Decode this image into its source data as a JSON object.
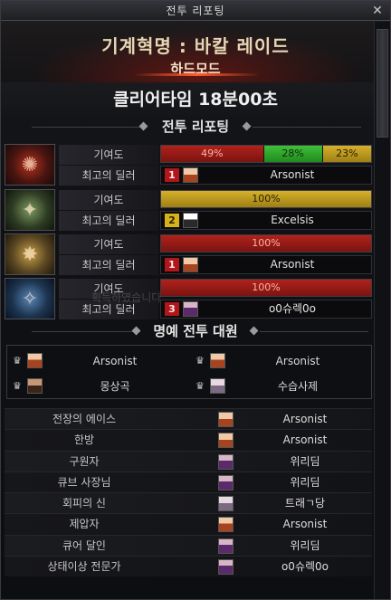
{
  "window": {
    "title": "전투 리포팅",
    "close": "✕"
  },
  "header": {
    "raid_title": "기계혁명 : 바칼 레이드",
    "mode": "하드모드"
  },
  "clear_time": "클리어타임  18분00초",
  "battle_section": {
    "title": "전투 리포팅"
  },
  "labels": {
    "contribution": "기여도",
    "top_dealer": "최고의 딜러"
  },
  "bosses": [
    {
      "icon": "boss-red-icon",
      "glyph": "✺",
      "segments": [
        {
          "label": "49%",
          "color": "#b0221c",
          "value": 49
        },
        {
          "label": "28%",
          "color": "#3fbf3a",
          "value": 28
        },
        {
          "label": "23%",
          "color": "#d6b12c",
          "value": 23
        }
      ],
      "dealer": {
        "rank": "1",
        "name": "Arsonist",
        "avatar": "arsonist"
      }
    },
    {
      "icon": "boss-green-icon",
      "glyph": "✦",
      "segments": [
        {
          "label": "100%",
          "color": "#d6b12c",
          "value": 100
        }
      ],
      "dealer": {
        "rank": "2",
        "name": "Excelsis",
        "avatar": "excelsis"
      }
    },
    {
      "icon": "boss-gold-icon",
      "glyph": "✸",
      "segments": [
        {
          "label": "100%",
          "color": "#b0221c",
          "value": 100
        }
      ],
      "dealer": {
        "rank": "1",
        "name": "Arsonist",
        "avatar": "arsonist"
      }
    },
    {
      "icon": "boss-blue-icon",
      "glyph": "✧",
      "segments": [
        {
          "label": "100%",
          "color": "#b0221c",
          "value": 100
        }
      ],
      "dealer": {
        "rank": "3",
        "name": "o0슈렉0o",
        "avatar": "dark"
      }
    }
  ],
  "overlay_text": "획득하였습니다",
  "honor_section": {
    "title": "명예 전투 대원",
    "members": [
      {
        "name": "Arsonist",
        "avatar": "arsonist"
      },
      {
        "name": "Arsonist",
        "avatar": "arsonist"
      },
      {
        "name": "몽상곡",
        "avatar": "brown"
      },
      {
        "name": "수습사제",
        "avatar": "pale"
      }
    ]
  },
  "awards": [
    {
      "title": "전장의 에이스",
      "name": "Arsonist",
      "avatar": "arsonist"
    },
    {
      "title": "한방",
      "name": "Arsonist",
      "avatar": "arsonist"
    },
    {
      "title": "구원자",
      "name": "위리딤",
      "avatar": "dark"
    },
    {
      "title": "큐브 사장님",
      "name": "위리딤",
      "avatar": "dark"
    },
    {
      "title": "회피의 신",
      "name": "트래ㄱ당",
      "avatar": "pale"
    },
    {
      "title": "제압자",
      "name": "Arsonist",
      "avatar": "arsonist"
    },
    {
      "title": "큐어 달인",
      "name": "위리딤",
      "avatar": "dark"
    },
    {
      "title": "상태이상 전문가",
      "name": "o0슈렉0o",
      "avatar": "dark"
    }
  ]
}
